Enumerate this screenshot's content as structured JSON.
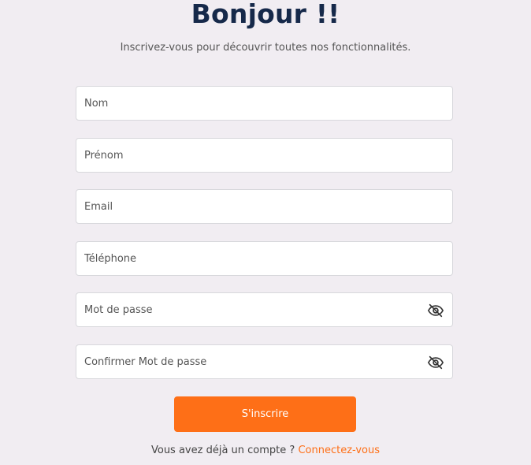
{
  "header": {
    "title": "Bonjour !!",
    "subtitle": "Inscrivez-vous pour découvrir toutes nos fonctionnalités."
  },
  "form": {
    "fields": [
      {
        "placeholder": "Nom",
        "type": "text"
      },
      {
        "placeholder": "Prénom",
        "type": "text"
      },
      {
        "placeholder": "Email",
        "type": "email"
      },
      {
        "placeholder": "Téléphone",
        "type": "tel"
      },
      {
        "placeholder": "Mot de passe",
        "type": "password",
        "icon": "eye-slash-icon"
      },
      {
        "placeholder": "Confirmer Mot de passe",
        "type": "password",
        "icon": "eye-slash-icon"
      }
    ],
    "submit_label": "S'inscrire"
  },
  "footer": {
    "prompt": "Vous avez déjà un compte ?",
    "link_label": "Connectez-vous"
  },
  "colors": {
    "background": "#f1edf2",
    "title": "#16294a",
    "accent": "#fe6f17"
  }
}
